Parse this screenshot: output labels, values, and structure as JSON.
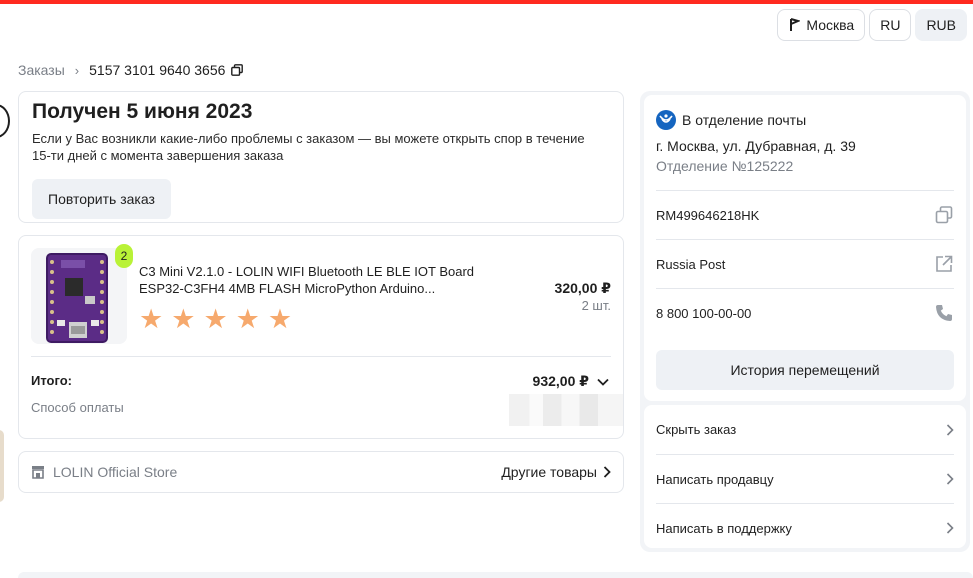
{
  "header": {
    "location": "Москва",
    "language": "RU",
    "currency": "RUB",
    "accent_color": "#ff2a1f"
  },
  "breadcrumb": {
    "root": "Заказы",
    "order_number": "5157 3101 9640 3656"
  },
  "status": {
    "title": "Получен 5 июня 2023",
    "text": "Если у Вас возникли какие-либо проблемы с заказом — вы можете открыть спор в течение 15-ти дней с момента завершения заказа",
    "repeat_button": "Повторить заказ"
  },
  "product": {
    "badge": "2",
    "title_line1": "C3 Mini V2.1.0 - LOLIN WIFI Bluetooth LE BLE IOT Board",
    "title_line2": "ESP32-C3FH4 4MB FLASH MicroPython Arduino...",
    "price": "320,00 ₽",
    "quantity": "2 шт.",
    "rating": 5,
    "rating_max": 5,
    "star_color": "#f6a96d",
    "badge_color": "#b9f237"
  },
  "summary": {
    "total_label": "Итого:",
    "total_value": "932,00 ₽",
    "payment_label": "Способ оплаты"
  },
  "store": {
    "name": "LOLIN Official Store",
    "other_goods": "Другие товары"
  },
  "delivery": {
    "method": "В отделение почты",
    "address": "г. Москва, ул. Дубравная, д. 39",
    "branch": "Отделение №125222",
    "tracking": "RM499646218HK",
    "carrier": "Russia Post",
    "phone": "8 800 100-00-00",
    "history_button": "История перемещений"
  },
  "actions": {
    "hide_order": "Скрыть заказ",
    "write_seller": "Написать продавцу",
    "write_support": "Написать в поддержку"
  },
  "icons": {
    "location": "map-pin-icon",
    "copy": "copy-icon",
    "external": "external-link-icon",
    "phone": "phone-icon",
    "store": "store-icon",
    "post": "russian-post-logo",
    "chevron": "chevron-right-icon"
  }
}
